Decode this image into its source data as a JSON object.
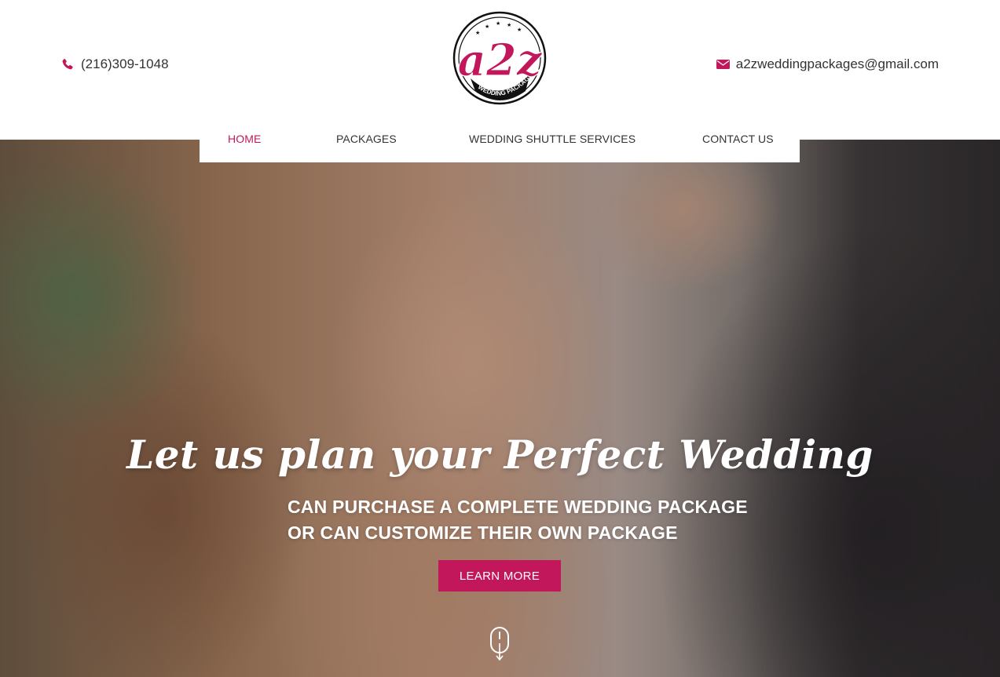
{
  "colors": {
    "accent": "#c2185b",
    "text": "#333333",
    "header_bg": "#ffffff"
  },
  "header": {
    "phone": {
      "icon": "phone-icon",
      "text": "(216)309-1048"
    },
    "email": {
      "icon": "envelope-icon",
      "text": "a2zweddingpackages@gmail.com"
    },
    "logo": {
      "main_text": "a2z",
      "ring_text": "WEDDING PACKAGES"
    }
  },
  "nav": {
    "items": [
      {
        "label": "HOME",
        "active": true
      },
      {
        "label": "PACKAGES",
        "active": false
      },
      {
        "label": "WEDDING SHUTTLE SERVICES",
        "active": false
      },
      {
        "label": "CONTACT US",
        "active": false
      }
    ]
  },
  "hero": {
    "headline": "Let us plan your Perfect Wedding",
    "subline_1": "CAN PURCHASE A COMPLETE WEDDING PACKAGE",
    "subline_2": "OR CAN CUSTOMIZE THEIR OWN PACKAGE",
    "cta_label": "LEARN MORE",
    "scroll_icon": "mouse-scroll-icon"
  }
}
